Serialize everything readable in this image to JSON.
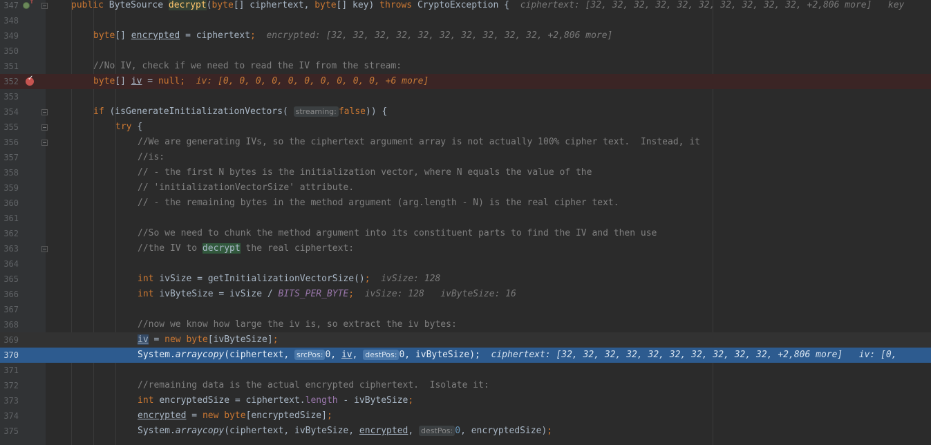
{
  "editor": {
    "lines": [
      {
        "num": "347",
        "tokens": [
          [
            "kw",
            "public "
          ],
          [
            "",
            "ByteSource "
          ],
          [
            "fn mhl",
            "decrypt"
          ],
          [
            "",
            "("
          ],
          [
            "kw",
            "byte"
          ],
          [
            "",
            "[] ciphertext, "
          ],
          [
            "kw",
            "byte"
          ],
          [
            "",
            "[] key) "
          ],
          [
            "kw",
            "throws "
          ],
          [
            "",
            "CryptoException {  "
          ],
          [
            "inl",
            "ciphertext: [32, 32, 32, 32, 32, 32, 32, 32, 32, 32, +2,806 more]   key"
          ]
        ]
      },
      {
        "num": "348",
        "tokens": []
      },
      {
        "num": "349",
        "tokens": [
          [
            "kw",
            "byte"
          ],
          [
            "",
            "[] "
          ],
          [
            "ul",
            "encrypted"
          ],
          [
            "",
            " = ciphertext"
          ],
          [
            "kw",
            ";"
          ],
          [
            "",
            ""
          ],
          [
            "inl",
            "  encrypted: [32, 32, 32, 32, 32, 32, 32, 32, 32, 32, +2,806 more]"
          ]
        ]
      },
      {
        "num": "350",
        "tokens": []
      },
      {
        "num": "351",
        "tokens": [
          [
            "cm",
            "//No IV, check if we need to read the IV from the stream:"
          ]
        ]
      },
      {
        "num": "352",
        "tokens": [
          [
            "kw",
            "byte"
          ],
          [
            "",
            "[] "
          ],
          [
            "ul",
            "iv"
          ],
          [
            "",
            " = "
          ],
          [
            "kw",
            "null"
          ],
          [
            "kw",
            ";"
          ],
          [
            "inl",
            "  iv: [0, 0, 0, 0, 0, 0, 0, 0, 0, 0, +6 more]"
          ]
        ]
      },
      {
        "num": "353",
        "tokens": []
      },
      {
        "num": "354",
        "tokens": [
          [
            "kw",
            "if "
          ],
          [
            "",
            "(isGenerateInitializationVectors( "
          ],
          [
            "hint-label",
            "streaming:"
          ],
          [
            "kw",
            "false"
          ],
          [
            "",
            ")) {"
          ]
        ]
      },
      {
        "num": "355",
        "tokens": [
          [
            "kw",
            "try "
          ],
          [
            "",
            "{"
          ]
        ]
      },
      {
        "num": "356",
        "tokens": [
          [
            "cm",
            "//We are generating IVs, so the ciphertext argument array is not actually 100% cipher text.  Instead, it"
          ]
        ]
      },
      {
        "num": "357",
        "tokens": [
          [
            "cm",
            "//is:"
          ]
        ]
      },
      {
        "num": "358",
        "tokens": [
          [
            "cm",
            "// - the first N bytes is the initialization vector, where N equals the value of the"
          ]
        ]
      },
      {
        "num": "359",
        "tokens": [
          [
            "cm",
            "// 'initializationVectorSize' attribute."
          ]
        ]
      },
      {
        "num": "360",
        "tokens": [
          [
            "cm",
            "// - the remaining bytes in the method argument (arg.length - N) is the real cipher text."
          ]
        ]
      },
      {
        "num": "361",
        "tokens": []
      },
      {
        "num": "362",
        "tokens": [
          [
            "cm",
            "//So we need to chunk the method argument into its constituent parts to find the IV and then use"
          ]
        ]
      },
      {
        "num": "363",
        "tokens": [
          [
            "cm",
            "//the IV to "
          ],
          [
            "fhl",
            "decrypt"
          ],
          [
            "cm",
            " the real ciphertext:"
          ]
        ]
      },
      {
        "num": "364",
        "tokens": []
      },
      {
        "num": "365",
        "tokens": [
          [
            "kw",
            "int "
          ],
          [
            "",
            "ivSize = getInitializationVectorSize()"
          ],
          [
            "kw",
            ";"
          ],
          [
            "inl",
            "  ivSize: 128"
          ]
        ]
      },
      {
        "num": "366",
        "tokens": [
          [
            "kw",
            "int "
          ],
          [
            "",
            "ivByteSize = ivSize / "
          ],
          [
            "const",
            "BITS_PER_BYTE"
          ],
          [
            "kw",
            ";"
          ],
          [
            "inl",
            "  ivSize: 128   ivByteSize: 16"
          ]
        ]
      },
      {
        "num": "367",
        "tokens": []
      },
      {
        "num": "368",
        "tokens": [
          [
            "cm",
            "//now we know how large the iv is, so extract the iv bytes:"
          ]
        ]
      },
      {
        "num": "369",
        "tokens": [
          [
            "ul id-hl",
            "iv"
          ],
          [
            "",
            " = "
          ],
          [
            "kw",
            "new byte"
          ],
          [
            "",
            "[ivByteSize]"
          ],
          [
            "kw",
            ";"
          ]
        ]
      },
      {
        "num": "370",
        "tokens": [
          [
            "",
            "System."
          ],
          [
            "st",
            "arraycopy"
          ],
          [
            "",
            "(ciphertext, "
          ],
          [
            "hint-label",
            "srcPos:"
          ],
          [
            "num",
            "0"
          ],
          [
            "",
            ", "
          ],
          [
            "ul",
            "iv"
          ],
          [
            "",
            ", "
          ],
          [
            "hint-label",
            "destPos:"
          ],
          [
            "num",
            "0"
          ],
          [
            "",
            ", ivByteSize)"
          ],
          [
            "kw",
            ";"
          ],
          [
            "inl",
            "  ciphertext: [32, 32, 32, 32, 32, 32, 32, 32, 32, 32, +2,806 more]   iv: [0,"
          ]
        ]
      },
      {
        "num": "371",
        "tokens": []
      },
      {
        "num": "372",
        "tokens": [
          [
            "cm",
            "//remaining data is the actual encrypted ciphertext.  Isolate it:"
          ]
        ]
      },
      {
        "num": "373",
        "tokens": [
          [
            "kw",
            "int "
          ],
          [
            "",
            "encryptedSize = ciphertext."
          ],
          [
            "fld",
            "length"
          ],
          [
            "",
            " - ivByteSize"
          ],
          [
            "kw",
            ";"
          ]
        ]
      },
      {
        "num": "374",
        "tokens": [
          [
            "ul",
            "encrypted"
          ],
          [
            "",
            " = "
          ],
          [
            "kw",
            "new byte"
          ],
          [
            "",
            "[encryptedSize]"
          ],
          [
            "kw",
            ";"
          ]
        ]
      },
      {
        "num": "375",
        "tokens": [
          [
            "",
            "System."
          ],
          [
            "st",
            "arraycopy"
          ],
          [
            "",
            "(ciphertext, ivByteSize, "
          ],
          [
            "ul",
            "encrypted"
          ],
          [
            "",
            ", "
          ],
          [
            "hint-label",
            "destPos:"
          ],
          [
            "num",
            "0"
          ],
          [
            "",
            ", encryptedSize)"
          ],
          [
            "kw",
            ";"
          ]
        ]
      }
    ]
  }
}
